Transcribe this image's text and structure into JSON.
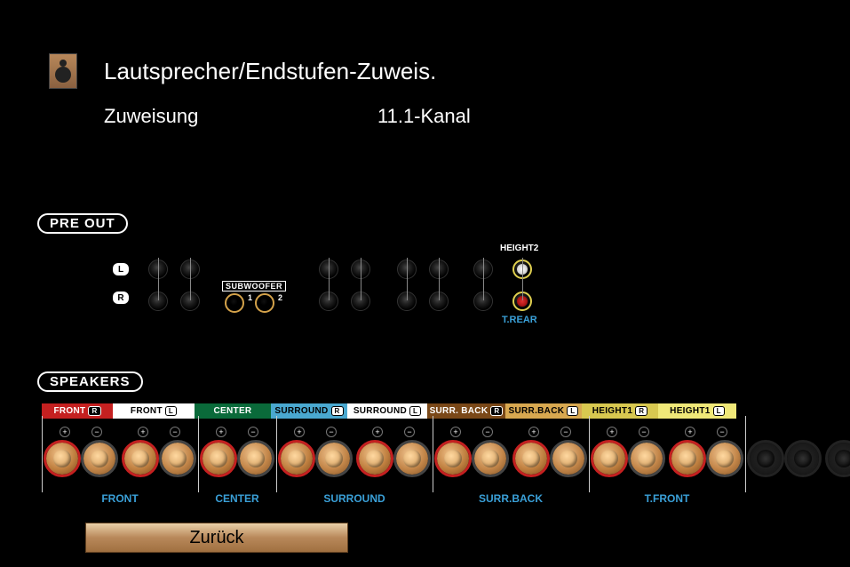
{
  "header": {
    "title": "Lautsprecher/Endstufen-Zuweis.",
    "assignment_label": "Zuweisung",
    "assignment_value": "11.1-Kanal"
  },
  "preout": {
    "section_label": "PRE OUT",
    "l": "L",
    "r": "R",
    "subwoofer": "SUBWOOFER",
    "sub1": "1",
    "sub2": "2",
    "height2": "HEIGHT2",
    "trear": "T.REAR"
  },
  "speakers": {
    "section_label": "SPEAKERS",
    "tabs": [
      {
        "label": "FRONT",
        "ch": "R",
        "bg": "#c42020",
        "w": 80,
        "text": "white"
      },
      {
        "label": "FRONT",
        "ch": "L",
        "bg": "#ffffff",
        "w": 92,
        "text": "black"
      },
      {
        "label": "CENTER",
        "ch": "",
        "bg": "#0a6a3a",
        "w": 86,
        "text": "white"
      },
      {
        "label": "SURROUND",
        "ch": "R",
        "bg": "#4aa8d0",
        "w": 86,
        "text": "black"
      },
      {
        "label": "SURROUND",
        "ch": "L",
        "bg": "#ffffff",
        "w": 90,
        "text": "black"
      },
      {
        "label": "SURR. BACK",
        "ch": "R",
        "bg": "#7a4818",
        "w": 88,
        "text": "white"
      },
      {
        "label": "SURR.BACK",
        "ch": "L",
        "bg": "#d8a850",
        "w": 86,
        "text": "black"
      },
      {
        "label": "HEIGHT1",
        "ch": "R",
        "bg": "#d8c850",
        "w": 86,
        "text": "black"
      },
      {
        "label": "HEIGHT1",
        "ch": "L",
        "bg": "#f0e878",
        "w": 88,
        "text": "black"
      }
    ],
    "assign": [
      {
        "label": "FRONT",
        "w": 176
      },
      {
        "label": "CENTER",
        "w": 88
      },
      {
        "label": "SURROUND",
        "w": 176
      },
      {
        "label": "SURR.BACK",
        "w": 176
      },
      {
        "label": "T.FRONT",
        "w": 176
      }
    ],
    "plus": "+",
    "minus": "−"
  },
  "back_button": "Zurück"
}
